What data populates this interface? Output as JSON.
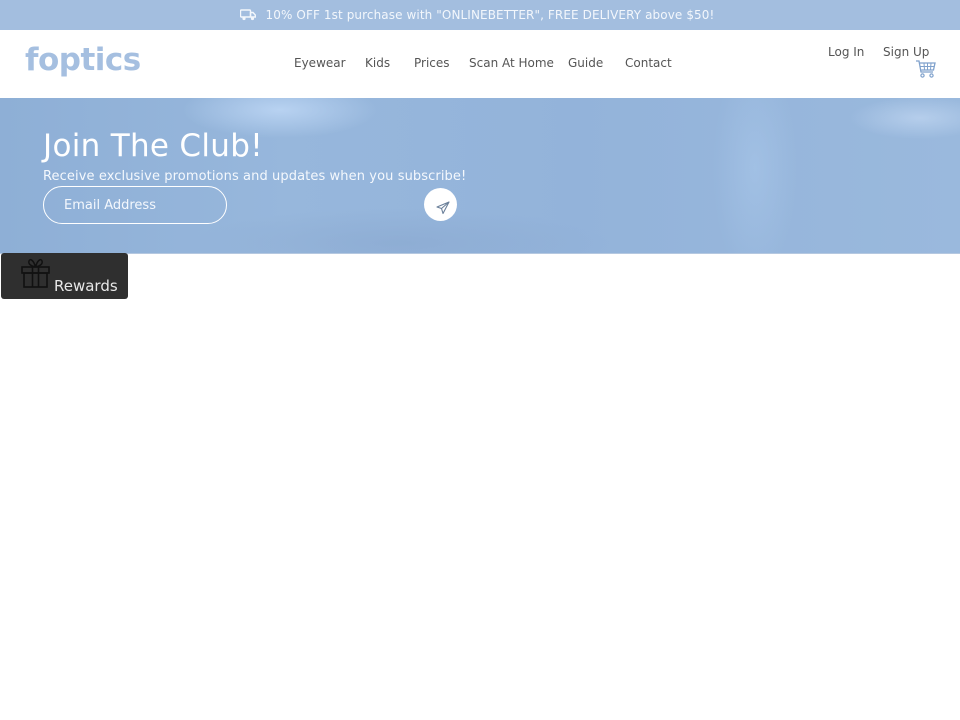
{
  "promo_bar": {
    "icon": "delivery-truck-icon",
    "text": "10% OFF 1st purchase with \"ONLINEBETTER\", FREE DELIVERY above $50!"
  },
  "header": {
    "logo": "foptics",
    "nav": [
      {
        "label": "Eyewear"
      },
      {
        "label": "Kids"
      },
      {
        "label": "Prices"
      },
      {
        "label": "Scan At Home"
      },
      {
        "label": "Guide"
      },
      {
        "label": "Contact"
      }
    ],
    "auth": {
      "login": "Log In",
      "signup": "Sign Up"
    },
    "cart_icon": "shopping-cart-icon"
  },
  "hero": {
    "title": "Join The Club!",
    "subtitle": "Receive exclusive promotions and updates when you subscribe!",
    "email_placeholder": "Email Address",
    "email_value": "",
    "send_icon": "paper-plane-icon"
  },
  "rewards": {
    "label": "Rewards",
    "icon": "gift-icon"
  },
  "colors": {
    "brand": "#a5bfe0",
    "promo_bar_bg": "#a3bedf",
    "hero_bg": "#93b3da",
    "rewards_bg": "#2f2f2f"
  }
}
